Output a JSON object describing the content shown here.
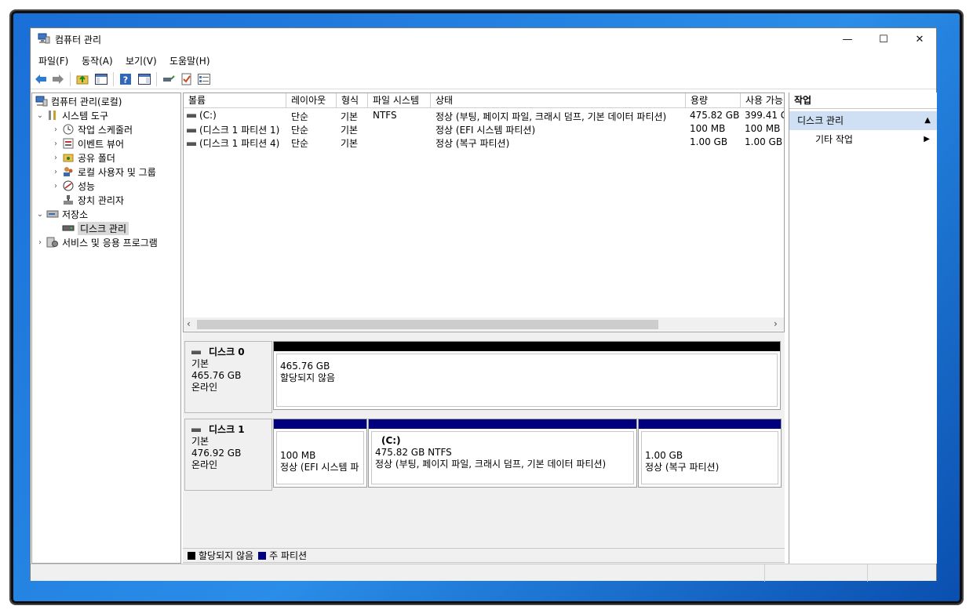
{
  "window": {
    "title": "컴퓨터 관리",
    "minimize_glyph": "—",
    "maximize_glyph": "☐",
    "close_glyph": "✕"
  },
  "menu": [
    "파일(F)",
    "동작(A)",
    "보기(V)",
    "도움말(H)"
  ],
  "toolbar_icons": [
    "back-arrow-icon",
    "forward-arrow-icon",
    "up-folder-icon",
    "show-hide-tree-icon",
    "help-icon",
    "show-hide-action-icon",
    "connect-icon",
    "properties-icon",
    "list-icon"
  ],
  "tree": {
    "root": "컴퓨터 관리(로컬)",
    "system_tools": "시스템 도구",
    "task_scheduler": "작업 스케줄러",
    "event_viewer": "이벤트 뷰어",
    "shared_folders": "공유 폴더",
    "local_users": "로컬 사용자 및 그룹",
    "performance": "성능",
    "device_manager": "장치 관리자",
    "storage": "저장소",
    "disk_management": "디스크 관리",
    "services_apps": "서비스 및 응용 프로그램"
  },
  "volume_list": {
    "headers": [
      "볼륨",
      "레이아웃",
      "형식",
      "파일 시스템",
      "상태",
      "용량",
      "사용 가능"
    ],
    "rows": [
      {
        "volume": "(C:)",
        "layout": "단순",
        "type": "기본",
        "fs": "NTFS",
        "status": "정상 (부팅, 페이지 파일, 크래시 덤프, 기본 데이터 파티션)",
        "capacity": "475.82 GB",
        "free": "399.41 G"
      },
      {
        "volume": "(디스크 1 파티션 1)",
        "layout": "단순",
        "type": "기본",
        "fs": "",
        "status": "정상 (EFI 시스템 파티션)",
        "capacity": "100 MB",
        "free": "100 MB"
      },
      {
        "volume": "(디스크 1 파티션 4)",
        "layout": "단순",
        "type": "기본",
        "fs": "",
        "status": "정상 (복구 파티션)",
        "capacity": "1.00 GB",
        "free": "1.00 GB"
      }
    ]
  },
  "disks": [
    {
      "name": "디스크 0",
      "kind": "기본",
      "size": "465.76 GB",
      "state": "온라인",
      "partitions": [
        {
          "label": "",
          "size": "465.76 GB",
          "status": "할당되지 않음",
          "color": "#000000"
        }
      ]
    },
    {
      "name": "디스크 1",
      "kind": "기본",
      "size": "476.92 GB",
      "state": "온라인",
      "partitions": [
        {
          "label": "",
          "size": "100 MB",
          "status": "정상 (EFI 시스템 파",
          "color": "#00007f"
        },
        {
          "label": "(C:)",
          "size": "475.82 GB NTFS",
          "status": "정상 (부팅, 페이지 파일, 크래시 덤프, 기본 데이터 파티션)",
          "color": "#00007f"
        },
        {
          "label": "",
          "size": "1.00 GB",
          "status": "정상 (복구 파티션)",
          "color": "#00007f"
        }
      ]
    }
  ],
  "legend": [
    {
      "label": "할당되지 않음",
      "color": "#000000"
    },
    {
      "label": "주 파티션",
      "color": "#00007f"
    }
  ],
  "actions": {
    "header": "작업",
    "section": "디스크 관리",
    "item": "기타 작업"
  }
}
